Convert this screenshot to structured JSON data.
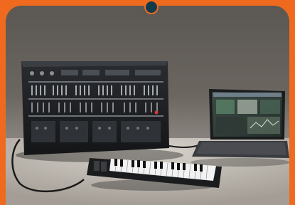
{
  "scene": {
    "description_colors": {
      "border": "#ef6a1f",
      "dot": "#123a4c",
      "wall": "#5b5753",
      "floor": "#bdb8b2",
      "synth_panel": "#1d1f22",
      "laptop_screen": "#2c3c35"
    },
    "objects": [
      "modular-synthesizer",
      "midi-keyboard",
      "laptop",
      "cable"
    ]
  }
}
